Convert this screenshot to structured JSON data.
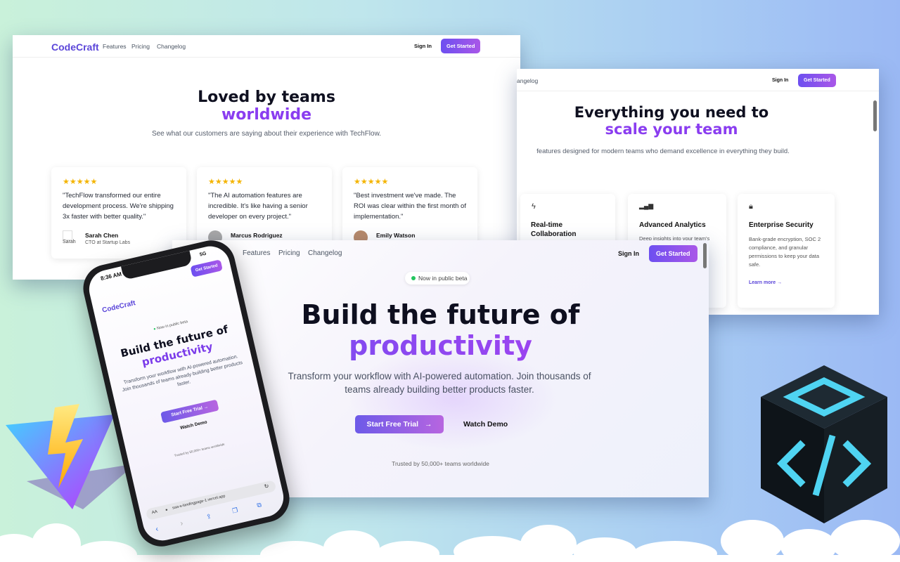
{
  "brand": "CodeCraft",
  "nav": {
    "features": "Features",
    "pricing": "Pricing",
    "changelog": "Changelog",
    "changelog_partial": "angelog",
    "sign_in": "Sign In",
    "get_started": "Get Started"
  },
  "testimonials": {
    "title_line1": "Loved by teams",
    "title_line2": "worldwide",
    "subtitle": "See what our customers are saying about their experience with TechFlow.",
    "stars": "★★★★★",
    "items": [
      {
        "quote": "\"TechFlow transformed our entire development process. We're shipping 3x faster with better quality.\"",
        "name": "Sarah Chen",
        "role": "CTO at Startup Labs",
        "avatar_alt": "Sarah"
      },
      {
        "quote": "\"The AI automation features are incredible. It's like having a senior developer on every project.\"",
        "name": "Marcus Rodriguez",
        "role": ""
      },
      {
        "quote": "\"Best investment we've made. The ROI was clear within the first month of implementation.\"",
        "name": "Emily Watson",
        "role": ""
      }
    ]
  },
  "features": {
    "title_line1": "Everything you need to",
    "title_line2": "scale your team",
    "subtitle": "features designed for modern teams who demand excellence in everything they build.",
    "items": [
      {
        "icon": "lightning-icon",
        "title": "Real-time Collaboration",
        "desc": ""
      },
      {
        "icon": "bar-chart-icon",
        "title": "Advanced Analytics",
        "desc": "Deep insights into your team's"
      },
      {
        "icon": "lock-icon",
        "title": "Enterprise Security",
        "desc": "Bank-grade encryption, SOC 2 compliance, and granular permissions to keep your data safe.",
        "link": "Learn more →"
      }
    ]
  },
  "hero": {
    "badge": "Now in public beta",
    "title_line1": "Build the future of",
    "title_line2": "productivity",
    "subtitle": "Transform your workflow with AI-powered automation. Join thousands of teams already building better products faster.",
    "cta_primary": "Start Free Trial",
    "cta_secondary": "Watch Demo",
    "trusted": "Trusted by 50,000+ teams worldwide"
  },
  "phone": {
    "time": "8:36 AM",
    "status": "5G",
    "url": "saa-s-landingpage-1.vercel.app",
    "aa": "AA",
    "trusted": "Trusted by 50,000+ teams worldwide"
  },
  "colors": {
    "accent": "#6d4ff0",
    "accent2": "#a957e8",
    "gradient_text": "#8a3df0"
  }
}
